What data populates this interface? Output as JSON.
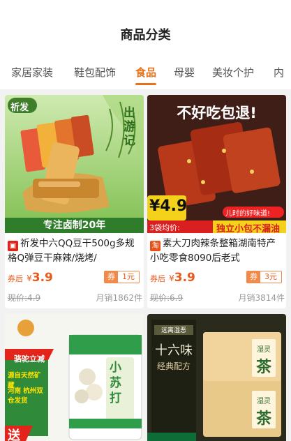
{
  "header": {
    "title": "商品分类"
  },
  "tabs": [
    {
      "label": "家居家装"
    },
    {
      "label": "鞋包配饰"
    },
    {
      "label": "食品",
      "active": true
    },
    {
      "label": "母婴"
    },
    {
      "label": "美妆个护"
    },
    {
      "label": "内"
    }
  ],
  "colors": {
    "accent": "#e8721a",
    "price": "#e85a1a",
    "coupon": "#f08a4b"
  },
  "products": [
    {
      "source_icon": "tmall-icon",
      "title": "祈发中六QQ豆干500g多规格Q弹豆干麻辣/烧烤/",
      "price_label": "券后",
      "currency": "¥",
      "price": "3.9",
      "coupon_label": "券",
      "coupon_value": "1元",
      "orig_price": "现价:4.9",
      "sales": "月销1862件",
      "image": {
        "brand": "祈发",
        "brand_sub": "出游记",
        "slogan": "专注卤制20年"
      }
    },
    {
      "source_icon": "taobao-icon",
      "source_text": "淘",
      "title": "素大刀肉辣条整箱湖南特产小吃零食8090后老式",
      "price_label": "券后",
      "currency": "¥",
      "price": "3.9",
      "coupon_label": "券",
      "coupon_value": "3元",
      "orig_price": "现价:6.9",
      "sales": "月销3814件",
      "image": {
        "headline": "不好吃包退!",
        "price_tag": "¥4.9",
        "price_note": "3袋均价:",
        "kid_note": "儿时的好味道!",
        "pack_note": "独立小包不漏油"
      }
    },
    {
      "image": {
        "side_label": "骆驼立减",
        "side_lines": [
          "源自天然矿藏",
          "河南 杭州双仓发货"
        ],
        "product": "小苏打",
        "corner": "送"
      }
    },
    {
      "image": {
        "top_label": "远离湿恶",
        "headline": "十六味",
        "sub": "经典配方",
        "box_text": "湿灵",
        "box_big": "茶"
      }
    }
  ]
}
